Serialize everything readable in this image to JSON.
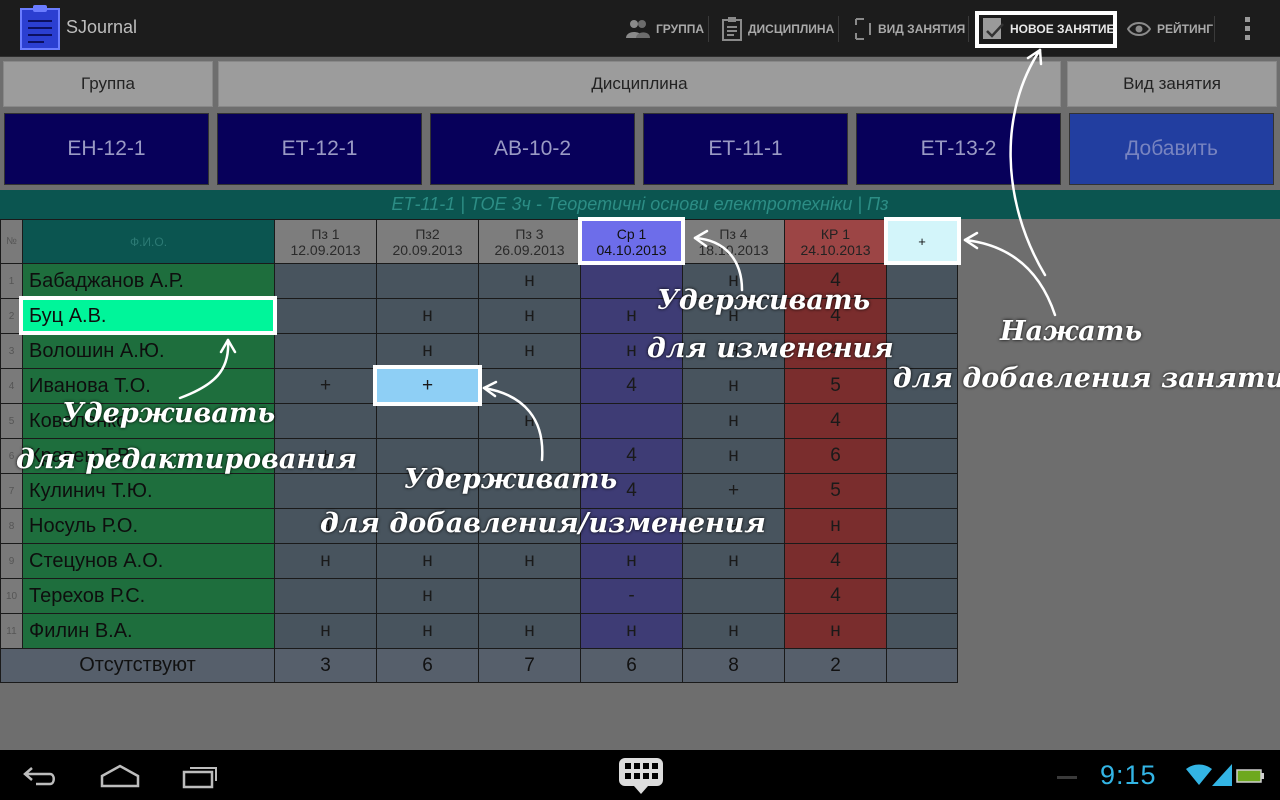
{
  "app": {
    "title": "SJournal"
  },
  "actions": [
    {
      "label": "ГРУППА",
      "icon": "group-icon"
    },
    {
      "label": "ДИСЦИПЛИНА",
      "icon": "clipboard-icon"
    },
    {
      "label": "ВИД ЗАНЯТИЯ",
      "icon": "lesson-type-icon"
    },
    {
      "label": "НОВОЕ ЗАНЯТИЕ",
      "icon": "new-lesson-icon"
    },
    {
      "label": "РЕЙТИНГ",
      "icon": "eye-icon"
    }
  ],
  "header": {
    "group": "Группа",
    "discipline": "Дисциплина",
    "lesson_type": "Вид занятия"
  },
  "groups": [
    "ЕН-12-1",
    "ЕТ-12-1",
    "АВ-10-2",
    "ЕТ-11-1",
    "ЕТ-13-2"
  ],
  "add_label": "Добавить",
  "info_line": "ЕТ-11-1  |  ТОЕ 3ч - Теоретичні основи електротехніки  |  Пз",
  "table": {
    "num_header": "№",
    "name_header": "Ф.И.О.",
    "columns": [
      {
        "title": "Пз 1",
        "date": "12.09.2013",
        "kind": "pz"
      },
      {
        "title": "Пз2",
        "date": "20.09.2013",
        "kind": "pz"
      },
      {
        "title": "Пз 3",
        "date": "26.09.2013",
        "kind": "pz"
      },
      {
        "title": "Ср 1",
        "date": "04.10.2013",
        "kind": "sr"
      },
      {
        "title": "Пз 4",
        "date": "18.10.2013",
        "kind": "pz"
      },
      {
        "title": "КР 1",
        "date": "24.10.2013",
        "kind": "kr"
      }
    ],
    "add_column": "+",
    "rows": [
      {
        "n": "1",
        "name": "Бабаджанов А.Р.",
        "cells": [
          "",
          "",
          "н",
          "",
          "н",
          "4"
        ]
      },
      {
        "n": "2",
        "name": "Буц А.В.",
        "cells": [
          "",
          "н",
          "н",
          "н",
          "н",
          "4"
        ]
      },
      {
        "n": "3",
        "name": "Волошин А.Ю.",
        "cells": [
          "",
          "н",
          "н",
          "н",
          "н",
          "4"
        ]
      },
      {
        "n": "4",
        "name": "Иванова Т.О.",
        "cells": [
          "+",
          "+",
          "",
          "4",
          "н",
          "5"
        ]
      },
      {
        "n": "5",
        "name": "Коваленко",
        "cells": [
          "",
          "",
          "н",
          "",
          "н",
          "4"
        ]
      },
      {
        "n": "6",
        "name": "Кравец Т.В.",
        "cells": [
          "+",
          "",
          "",
          "4",
          "н",
          "6"
        ]
      },
      {
        "n": "7",
        "name": "Кулинич Т.Ю.",
        "cells": [
          "",
          "",
          "",
          "4",
          "+",
          "5"
        ]
      },
      {
        "n": "8",
        "name": "Носуль Р.О.",
        "cells": [
          "н",
          "",
          "",
          "",
          "н",
          "н"
        ]
      },
      {
        "n": "9",
        "name": "Стецунов А.О.",
        "cells": [
          "н",
          "н",
          "н",
          "н",
          "н",
          "4"
        ]
      },
      {
        "n": "10",
        "name": "Терехов Р.С.",
        "cells": [
          "",
          "н",
          "",
          "-",
          "",
          "4"
        ]
      },
      {
        "n": "11",
        "name": "Филин В.А.",
        "cells": [
          "н",
          "н",
          "н",
          "н",
          "н",
          "н"
        ]
      }
    ],
    "totals_label": "Отсутствуют",
    "totals": [
      "3",
      "6",
      "7",
      "6",
      "8",
      "2"
    ]
  },
  "annotations": {
    "hold_to_change_1": "Удерживать",
    "hold_to_change_2": "для изменения",
    "tap_to_add_1": "Нажать",
    "tap_to_add_2": "для добавления занятия",
    "hold_to_edit_1": "Удерживать",
    "hold_to_edit_2": "для редактирования",
    "hold_to_add_1": "Удерживать",
    "hold_to_add_2": "для добавления/изменения"
  },
  "status": {
    "time": "9:15"
  },
  "colors": {
    "name_col": "#1e6e3d",
    "pz_col": "#48545e",
    "sr_col": "#3e3c75",
    "kr_col": "#7a2d2d",
    "selected_name": "#00f59a",
    "selected_cell": "#8ecff5",
    "clock": "#33b5e5"
  }
}
